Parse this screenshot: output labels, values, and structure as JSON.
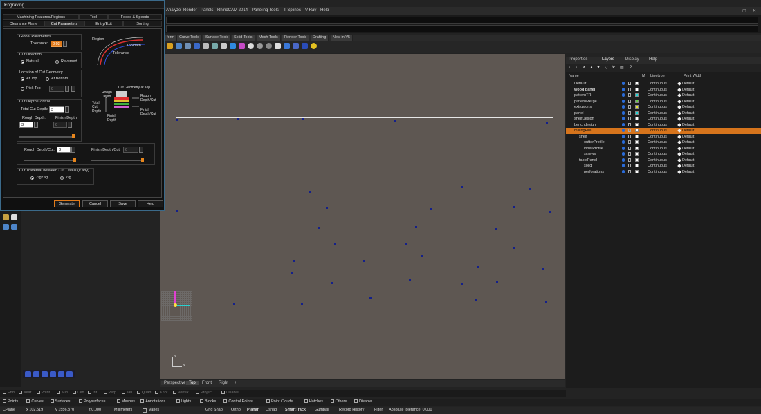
{
  "menu": [
    "Analyze",
    "Render",
    "Panels",
    "RhinoCAM 2014",
    "Paneling Tools",
    "T-Splines",
    "V-Ray",
    "Help"
  ],
  "toolbar_tabs": [
    "form",
    "Curve Tools",
    "Surface Tools",
    "Solid Tools",
    "Mesh Tools",
    "Render Tools",
    "Drafting",
    "New in V5"
  ],
  "viewport_tabs": [
    "Perspective",
    "Top",
    "Front",
    "Right"
  ],
  "viewport_axis": {
    "y": "y",
    "x": "x"
  },
  "panel": {
    "tabs": [
      "Properties",
      "Layers",
      "Display",
      "Help"
    ],
    "columns": {
      "name": "Name",
      "material": "M",
      "linetype": "Linetype",
      "print_width": "Print Width"
    },
    "layers": [
      {
        "name": "Default",
        "linetype": "Continuous",
        "print_width": "Default",
        "color": "#ffffff",
        "indent": 0,
        "selected": false,
        "bold": false
      },
      {
        "name": "wood panel",
        "linetype": "Continuous",
        "print_width": "Default",
        "color": "#ffffff",
        "indent": 0,
        "selected": false,
        "bold": true
      },
      {
        "name": "patternTRI",
        "linetype": "Continuous",
        "print_width": "Default",
        "color": "#1ad7d7",
        "indent": 0,
        "selected": false,
        "bold": false
      },
      {
        "name": "patternMerge",
        "linetype": "Continuous",
        "print_width": "Default",
        "color": "#66cc44",
        "indent": 0,
        "selected": false,
        "bold": false
      },
      {
        "name": "extrusions",
        "linetype": "Continuous",
        "print_width": "Default",
        "color": "#e6e62a",
        "indent": 0,
        "selected": false,
        "bold": false
      },
      {
        "name": "panel",
        "linetype": "Continuous",
        "print_width": "Default",
        "color": "#1ad7d7",
        "indent": 0,
        "selected": false,
        "bold": false
      },
      {
        "name": "shelfDesign",
        "linetype": "Continuous",
        "print_width": "Default",
        "color": "#ffffff",
        "indent": 0,
        "selected": false,
        "bold": false
      },
      {
        "name": "benchdesign",
        "linetype": "Continuous",
        "print_width": "Default",
        "color": "#ffffff",
        "indent": 0,
        "selected": false,
        "bold": false
      },
      {
        "name": "millingFile",
        "linetype": "Continuous",
        "print_width": "Default",
        "color": "#ffffff",
        "indent": 0,
        "selected": true,
        "bold": false
      },
      {
        "name": "shelf",
        "linetype": "Continuous",
        "print_width": "Default",
        "color": "#ffffff",
        "indent": 1,
        "selected": false,
        "bold": false
      },
      {
        "name": "outterProfile",
        "linetype": "Continuous",
        "print_width": "Default",
        "color": "#ffffff",
        "indent": 2,
        "selected": false,
        "bold": false
      },
      {
        "name": "innerProfile",
        "linetype": "Continuous",
        "print_width": "Default",
        "color": "#ffffff",
        "indent": 2,
        "selected": false,
        "bold": false
      },
      {
        "name": "screws",
        "linetype": "Continuous",
        "print_width": "Default",
        "color": "#ffffff",
        "indent": 2,
        "selected": false,
        "bold": false
      },
      {
        "name": "tablePanel",
        "linetype": "Continuous",
        "print_width": "Default",
        "color": "#ffffff",
        "indent": 1,
        "selected": false,
        "bold": false
      },
      {
        "name": "solid",
        "linetype": "Continuous",
        "print_width": "Default",
        "color": "#ffffff",
        "indent": 2,
        "selected": false,
        "bold": false
      },
      {
        "name": "perforations",
        "linetype": "Continuous",
        "print_width": "Default",
        "color": "#ffffff",
        "indent": 2,
        "selected": false,
        "bold": false
      }
    ]
  },
  "osnap": [
    "End",
    "Near",
    "Point",
    "Mid",
    "Cen",
    "Int",
    "Perp",
    "Tan",
    "Quad",
    "Knot",
    "Vertex",
    "Project",
    "Disable"
  ],
  "filters": [
    "Points",
    "Curves",
    "Surfaces",
    "Polysurfaces",
    "Meshes",
    "Annotations",
    "Lights",
    "Blocks",
    "Control Points",
    "Point Clouds",
    "Hatches",
    "Others",
    "Disable"
  ],
  "status": {
    "cplane": "CPlane",
    "x": "x 102.519",
    "y": "y 1556.370",
    "z": "z 0.000",
    "units": "Millimeters",
    "layer": "Varies",
    "toggles": [
      "Grid Snap",
      "Ortho",
      "Planar",
      "Osnap",
      "SmartTrack",
      "Gumball",
      "Record History",
      "Filter"
    ],
    "tolerance": "Absolute tolerance: 0.001"
  },
  "dialog": {
    "title": "Engraving",
    "tabs_row1": [
      "Machining Features/Regions",
      "Tool",
      "Feeds & Speeds"
    ],
    "tabs_row2": [
      "Clearance Plane",
      "Cut Parameters",
      "Entry/Exit",
      "Sorting"
    ],
    "global_params": "Global Parameters",
    "tolerance_label": "Tolerance:",
    "tolerance_value": "0.03",
    "cut_direction": "Cut Direction",
    "natural": "Natural",
    "reversed": "Reversed",
    "location": "Location of Cut Geometry",
    "at_top": "At Top",
    "at_bottom": "At Bottom",
    "pick_top": "Pick Top",
    "pick_top_value": "0",
    "depth_control": "Cut Depth Control",
    "total_depth_label": "Total Cut Depth:",
    "total_depth_value": "3",
    "rough_depth_label": "Rough Depth:",
    "rough_depth_value": "3",
    "finish_depth_label": "Finish Depth:",
    "finish_depth_value": "0",
    "rough_cut_label": "Rough Depth/Cut:",
    "rough_cut_value": "3",
    "finish_cut_label": "Finish Depth/Cut:",
    "finish_cut_value": "0",
    "traversal": "Cut Traversal between Cut Levels (if any)",
    "zigzag": "ZigZag",
    "zig": "Zig",
    "diagram_region": "Region",
    "diagram_toolpath": "Toolpath",
    "diagram_tolerance": "Tolerance",
    "diagram2": {
      "top": "Cut Geometry at Top",
      "rough_depth": "Rough Depth",
      "total": "Total Cut Depth",
      "finish": "Finish Depth",
      "rough_cut": "Rough Depth/Cut",
      "finish_cut": "Finish Depth/Cut"
    },
    "buttons": {
      "generate": "Generate",
      "cancel": "Cancel",
      "save": "Save",
      "help": "Help"
    }
  },
  "colors": {
    "accent": "#e07a1a",
    "viewport": "#5e5752",
    "selected_layer": "#d6741c"
  }
}
